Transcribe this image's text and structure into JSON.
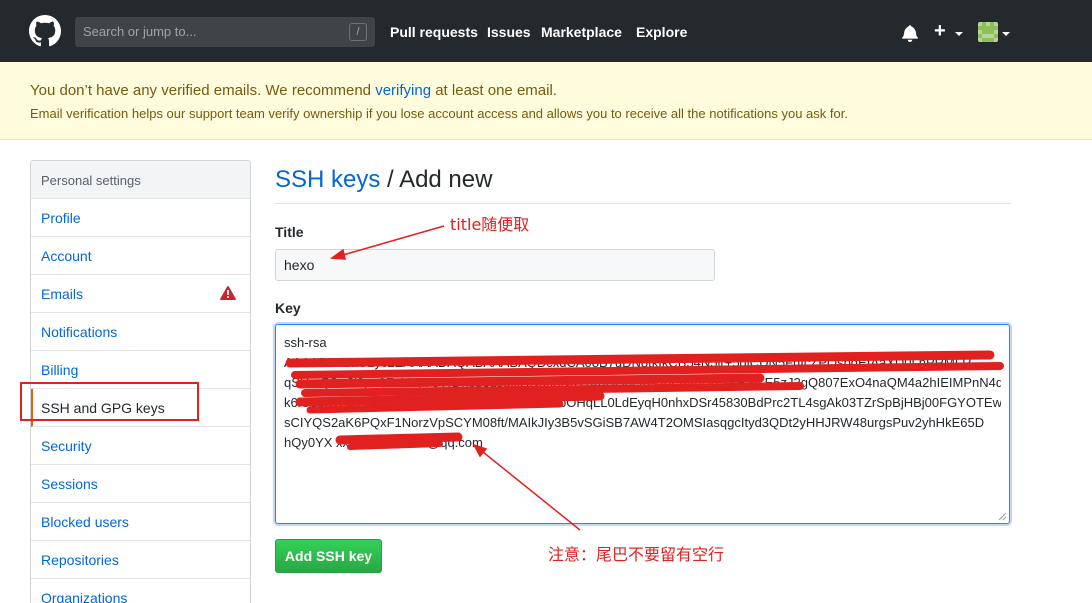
{
  "header": {
    "search_placeholder": "Search or jump to...",
    "search_key": "/",
    "nav": [
      "Pull requests",
      "Issues",
      "Marketplace",
      "Explore"
    ],
    "plus_label": "+"
  },
  "flash": {
    "title_before": "You don’t have any verified emails. We recommend ",
    "title_link": "verifying",
    "title_after": " at least one email.",
    "subtitle": "Email verification helps our support team verify ownership if you lose account access and allows you to receive all the notifications you ask for."
  },
  "sidebar": {
    "heading": "Personal settings",
    "items": [
      {
        "label": "Profile"
      },
      {
        "label": "Account"
      },
      {
        "label": "Emails"
      },
      {
        "label": "Notifications"
      },
      {
        "label": "Billing"
      },
      {
        "label": "SSH and GPG keys"
      },
      {
        "label": "Security"
      },
      {
        "label": "Sessions"
      },
      {
        "label": "Blocked users"
      },
      {
        "label": "Repositories"
      },
      {
        "label": "Organizations"
      }
    ]
  },
  "main": {
    "breadcrumb": "SSH keys",
    "separator": " / ",
    "page_title": "Add new",
    "title_label": "Title",
    "title_value": "hexo",
    "key_label": "Key",
    "key_lines": [
      "ssh-rsa",
      "AAAAB3NzaC1yc2EAAAADAQABAAABAQDcxdCA08B7uDN8tkIkCB54N5jr+5giCDN5FhIcZPQsbgEIAaXD0LnPRMLR",
      "qSHmQ0w2l8pe3F+VeyoQ7rDhsu6dJqlcHNd5nNhYfXnDQ8Ltq9J6PmmHrLYkRSGE5zJ2gQ807ExO4naQM4a2hIEIMPnN4qNxD8YFeHvvXk2AteRZ2YDdXj8",
      "k6lC6bXOYl1iSI6bHIK9ODnRVTYVRdzH5NOCbOHqLL0LdEyqH0nhxDSr45830BdPrc2TL4sgAk03TZrSpBjHBj00FGYOTEwJHO9N6zVKjItN",
      "sCIYQS2aK6PQxF1NorzVpSCYM08ft/MAIkJIy3B5vSGiSB7AW4T2OMSIasqgcItyd3QDt2yHHJRW48urgsPuv2yhHkE65D",
      "hQy0YX xxxxxxxxxxxxxx@qq.com"
    ],
    "submit_label": "Add SSH key"
  },
  "annotations": {
    "title_note": "title随便取",
    "key_note": "注意：尾巴不要留有空行"
  },
  "colors": {
    "header_bg": "#24292e",
    "link": "#0366d6",
    "flash_bg": "#fffbdd",
    "button_green": "#28a745",
    "annotation_red": "#e0211f",
    "selected_accent": "#e36209"
  }
}
